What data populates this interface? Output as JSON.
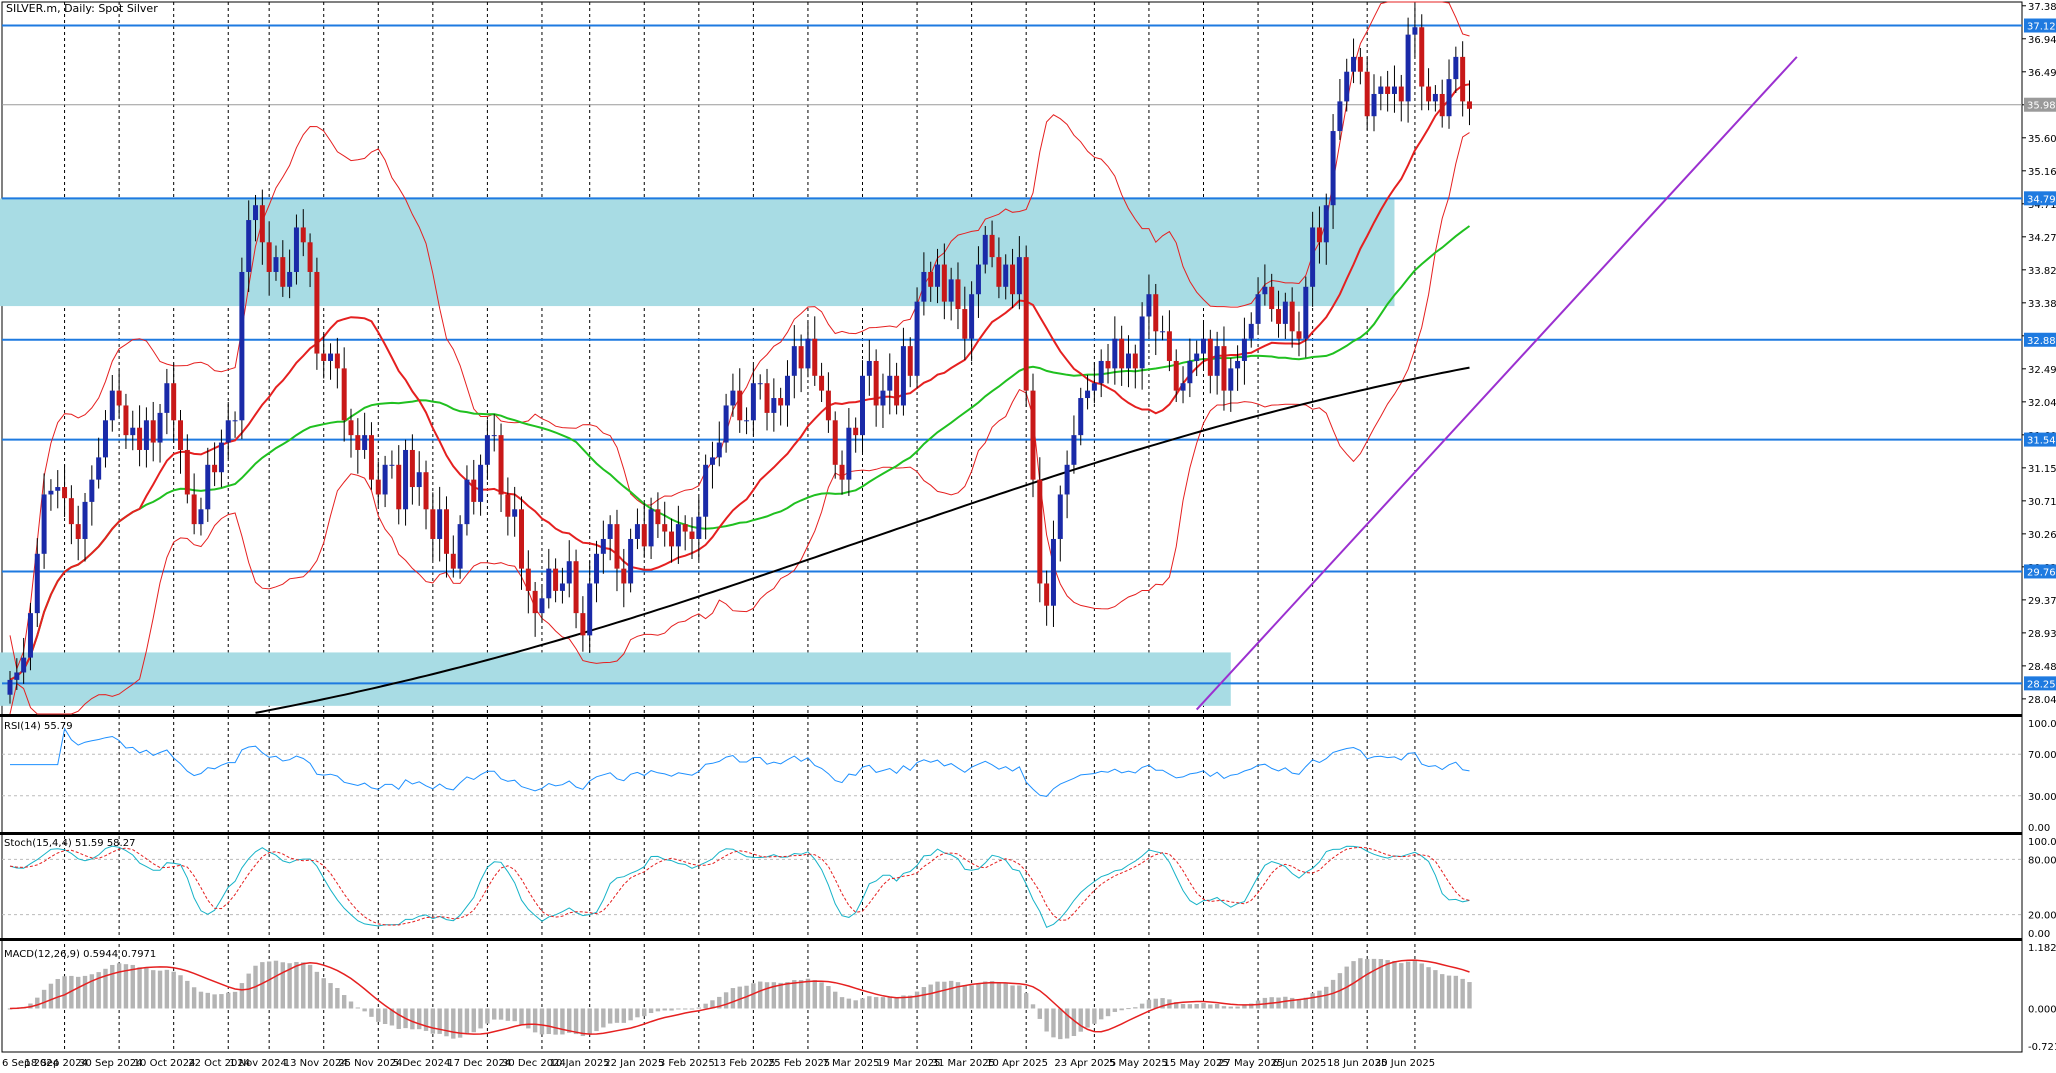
{
  "chart_data": {
    "type": "candlestick",
    "title": "SILVER.m, Daily:  Spot Silver",
    "y_axis_price": {
      "ticks": [
        "37.389",
        "36.944",
        "36.499",
        "36.054",
        "35.609",
        "35.164",
        "34.719",
        "34.274",
        "33.829",
        "33.384",
        "32.939",
        "32.494",
        "32.049",
        "31.604",
        "31.159",
        "30.714",
        "30.269",
        "29.824",
        "29.379",
        "28.934",
        "28.489",
        "28.044"
      ],
      "range": [
        27.84,
        37.44
      ]
    },
    "price_levels": [
      {
        "value": 37.123,
        "label": "37.123"
      },
      {
        "value": 34.793,
        "label": "34.793"
      },
      {
        "value": 32.886,
        "label": "32.886"
      },
      {
        "value": 31.54,
        "label": "31.540"
      },
      {
        "value": 29.762,
        "label": "29.762"
      },
      {
        "value": 28.253,
        "label": "28.253"
      }
    ],
    "current_price": {
      "value": 36.055,
      "label": "35.983"
    },
    "zones": [
      {
        "from_bar": 0,
        "to_bar": 203,
        "low": 33.34,
        "high": 34.79
      },
      {
        "from_bar": 0,
        "to_bar": 179,
        "low": 27.95,
        "high": 28.67
      }
    ],
    "x_axis": {
      "labels": [
        "6 Sep 2024",
        "18 Sep 2024",
        "30 Sep 2024",
        "10 Oct 2024",
        "22 Oct 2024",
        "1 Nov 2024",
        "13 Nov 2024",
        "25 Nov 2024",
        "5 Dec 2024",
        "17 Dec 2024",
        "30 Dec 2024",
        "10 Jan 2025",
        "22 Jan 2025",
        "3 Feb 2025",
        "13 Feb 2025",
        "25 Feb 2025",
        "7 Mar 2025",
        "19 Mar 2025",
        "31 Mar 2025",
        "10 Apr 2025",
        "23 Apr 2025",
        "5 May 2025",
        "15 May 2025",
        "27 May 2025",
        "6 Jun 2025",
        "18 Jun 2025",
        "30 Jun 2025"
      ],
      "label_bars": [
        0,
        8,
        16,
        24,
        32,
        38,
        46,
        54,
        62,
        70,
        78,
        85,
        93,
        101,
        109,
        117,
        125,
        133,
        141,
        149,
        159,
        167,
        175,
        183,
        191,
        199,
        206
      ]
    },
    "closes": [
      28.3,
      28.4,
      28.6,
      29.2,
      30.0,
      30.8,
      30.85,
      30.9,
      30.75,
      30.4,
      30.2,
      30.7,
      31.0,
      31.3,
      31.8,
      32.2,
      32.0,
      31.6,
      31.7,
      31.4,
      31.8,
      31.5,
      31.9,
      32.3,
      31.8,
      31.4,
      30.8,
      30.4,
      30.6,
      31.2,
      31.1,
      31.5,
      31.8,
      31.8,
      33.8,
      34.5,
      34.7,
      34.2,
      33.8,
      34.0,
      33.6,
      33.8,
      34.4,
      34.2,
      33.8,
      32.7,
      32.6,
      32.7,
      32.5,
      31.8,
      31.6,
      31.4,
      31.6,
      31.0,
      30.8,
      31.2,
      31.2,
      30.6,
      31.4,
      30.9,
      31.1,
      30.6,
      30.2,
      30.6,
      30.0,
      29.8,
      30.4,
      31.0,
      30.7,
      31.2,
      31.6,
      31.6,
      30.8,
      30.5,
      30.6,
      29.8,
      29.5,
      29.2,
      29.4,
      29.8,
      29.5,
      29.6,
      29.9,
      29.2,
      28.9,
      29.6,
      30.0,
      30.2,
      30.4,
      29.8,
      29.6,
      30.2,
      30.4,
      30.1,
      30.6,
      30.4,
      30.3,
      30.1,
      30.4,
      30.3,
      30.2,
      30.5,
      31.2,
      31.3,
      31.5,
      32.0,
      32.2,
      31.8,
      31.8,
      32.3,
      32.3,
      31.9,
      32.1,
      32.0,
      32.4,
      32.8,
      32.5,
      32.9,
      32.4,
      32.2,
      31.8,
      31.2,
      31.0,
      31.7,
      31.6,
      32.4,
      32.6,
      32.0,
      32.2,
      32.4,
      32.0,
      32.8,
      32.4,
      33.4,
      33.8,
      33.6,
      33.9,
      33.4,
      33.7,
      33.3,
      32.9,
      33.5,
      33.9,
      34.3,
      34.0,
      33.6,
      33.9,
      33.5,
      34.0,
      32.2,
      31.0,
      29.6,
      29.3,
      30.2,
      30.8,
      31.2,
      31.6,
      32.1,
      32.2,
      32.3,
      32.6,
      32.5,
      32.9,
      32.5,
      32.7,
      32.5,
      33.2,
      33.5,
      33.0,
      33.0,
      32.6,
      32.2,
      32.3,
      32.6,
      32.7,
      32.9,
      32.4,
      32.8,
      32.2,
      32.5,
      32.6,
      32.9,
      33.1,
      33.5,
      33.6,
      33.3,
      33.1,
      33.4,
      33.0,
      32.9,
      33.6,
      34.4,
      34.2,
      34.7,
      35.7,
      36.1,
      36.5,
      36.7,
      36.5,
      35.9,
      36.2,
      36.3,
      36.2,
      36.3,
      36.1,
      37.0,
      37.1,
      36.3,
      36.1,
      36.2,
      35.9,
      36.4,
      36.7,
      36.1,
      36.0
    ],
    "moving_averages": [
      {
        "name": "MA 20 (red)",
        "color": "#e52020"
      },
      {
        "name": "MA 50 (green)",
        "color": "#20c020"
      },
      {
        "name": "MA 200 (black)",
        "color": "#000000"
      }
    ],
    "bollinger_color": "#e52020",
    "trendline": {
      "color": "#9b30d0",
      "start": {
        "bar": 174,
        "price": 27.9
      },
      "end": {
        "bar": 262,
        "price": 36.7
      }
    },
    "rsi": {
      "label": "RSI(14) 55.79",
      "ticks": [
        "100.00",
        "70.00",
        "30.00",
        "0.00"
      ],
      "levels": [
        70,
        30
      ],
      "range": [
        0,
        100
      ],
      "color": "#1e90ff"
    },
    "stochastic": {
      "label": "Stoch(15,4,4) 51.59 58.27",
      "ticks": [
        "100.00",
        "80.00",
        "20.00",
        "0.00"
      ],
      "levels": [
        80,
        20
      ],
      "range": [
        0,
        100
      ],
      "main_color": "#17b3c8",
      "signal_color": "#e52020"
    },
    "macd": {
      "label": "MACD(12,26,9) 0.5944 0.7971",
      "ticks": [
        "1.1828",
        "0.0000",
        "-0.7218"
      ],
      "range": [
        -0.7218,
        1.1828
      ],
      "histogram_color": "#b4b4b4",
      "signal_color": "#e52020"
    },
    "colors": {
      "up": "#1a2aa8",
      "down": "#c81818",
      "level_line": "#1e7ae0",
      "zone": "#a8dce4",
      "bg": "#ffffff"
    }
  }
}
